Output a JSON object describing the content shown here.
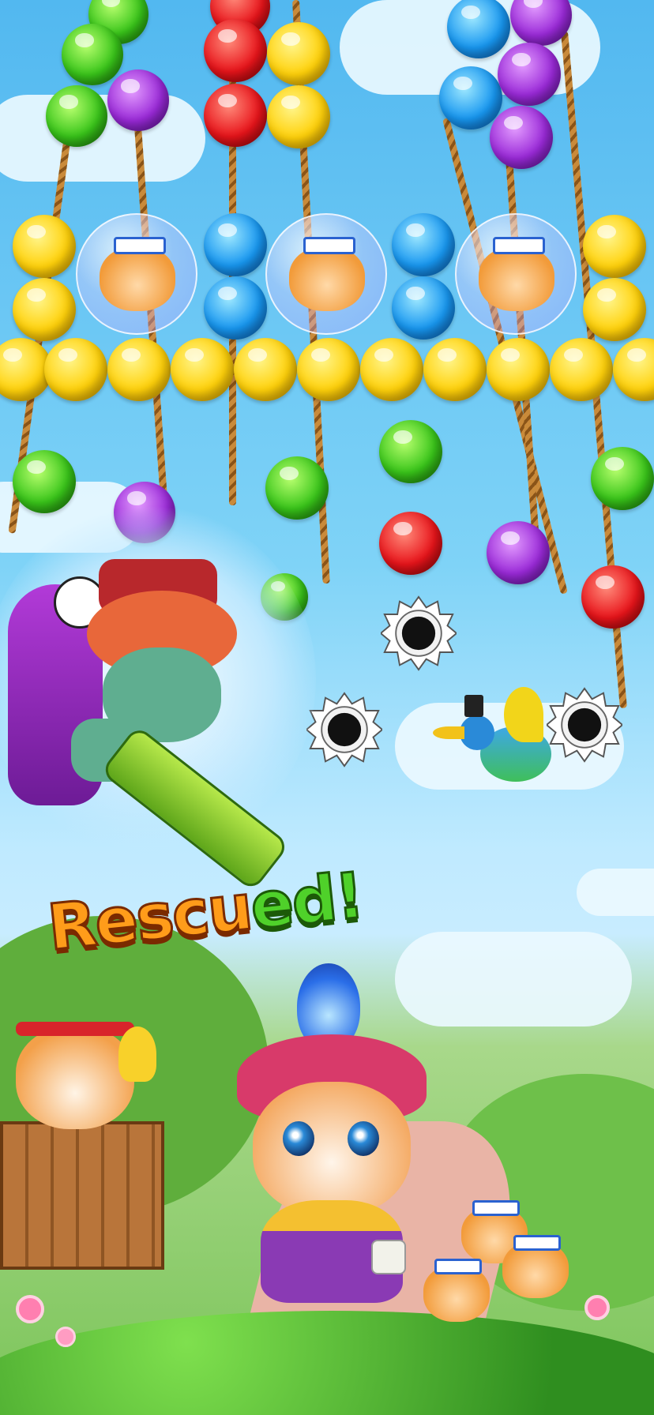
{
  "banner": {
    "part_a": "Rescu",
    "part_b": "ed!"
  },
  "bubble_colors": [
    "yellow",
    "red",
    "green",
    "blue",
    "purple"
  ],
  "colors": {
    "yellow": "#ffd10a",
    "red": "#e8151b",
    "green": "#39c51a",
    "blue": "#1897f0",
    "purple": "#9a2ad8"
  },
  "characters": [
    "caged-cat",
    "caged-cat",
    "caged-cat",
    "zombie-squirrel-boss",
    "toucan",
    "hero-cat",
    "hamster-on-crate",
    "rescued-cat",
    "rescued-cat",
    "rescued-cat"
  ],
  "hazards": [
    "saw-blade",
    "saw-blade",
    "saw-blade"
  ]
}
